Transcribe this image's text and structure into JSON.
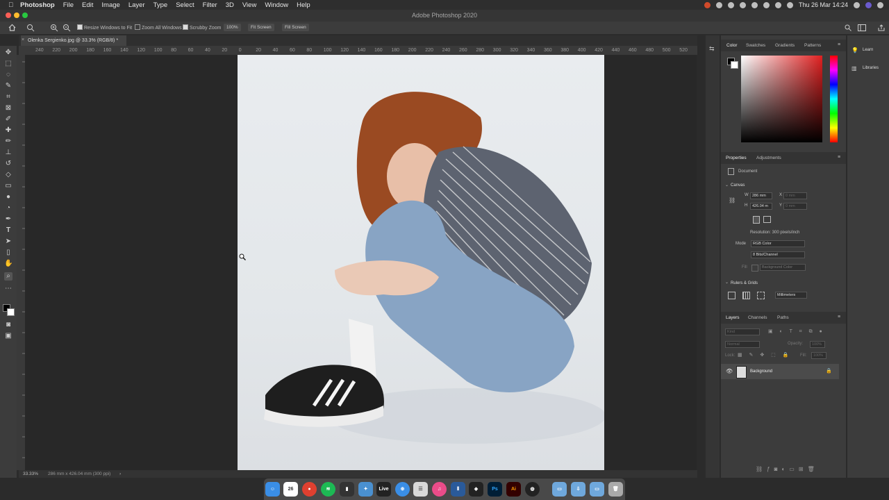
{
  "menubar": {
    "app": "Photoshop",
    "items": [
      "File",
      "Edit",
      "Image",
      "Layer",
      "Type",
      "Select",
      "Filter",
      "3D",
      "View",
      "Window",
      "Help"
    ],
    "clock": "Thu 26 Mar  14:24"
  },
  "window": {
    "title": "Adobe Photoshop 2020"
  },
  "options": {
    "resize_windows": "Resize Windows to Fit",
    "zoom_all": "Zoom All Windows",
    "scrubby_zoom": "Scrubby Zoom",
    "zoom_pct": "100%",
    "fit_screen": "Fit Screen",
    "fill_screen": "Fill Screen"
  },
  "document": {
    "tab_title": "Olenka Sergienko.jpg @ 33.3% (RGB/8) *"
  },
  "ruler": {
    "h_ticks": [
      "240",
      "220",
      "200",
      "180",
      "160",
      "140",
      "120",
      "100",
      "80",
      "60",
      "40",
      "20",
      "0",
      "20",
      "40",
      "60",
      "80",
      "100",
      "120",
      "140",
      "160",
      "180",
      "200",
      "220",
      "240",
      "260",
      "280",
      "300",
      "320",
      "340",
      "360",
      "380",
      "400",
      "420",
      "440",
      "460",
      "480",
      "500",
      "520"
    ]
  },
  "status": {
    "zoom": "33.33%",
    "size": "286 mm x 426.04 mm (300 ppi)"
  },
  "color_panel": {
    "tabs": [
      "Color",
      "Swatches",
      "Gradients",
      "Patterns"
    ]
  },
  "properties_panel": {
    "tabs": [
      "Properties",
      "Adjustments"
    ],
    "doc_label": "Document",
    "canvas_label": "Canvas",
    "w_label": "W",
    "w_value": "286 mm",
    "h_label": "H",
    "h_value": "426.04 m",
    "x_label": "X",
    "x_placeholder": "0 mm",
    "y_label": "Y",
    "y_placeholder": "0 mm",
    "resolution": "Resolution: 300 pixels/inch",
    "mode_label": "Mode",
    "mode_value": "RGB Color",
    "bits_value": "8 Bits/Channel",
    "fill_label": "Fill",
    "fill_value": "Background Color",
    "rulers_label": "Rulers & Grids",
    "units_value": "Millimeters"
  },
  "layers_panel": {
    "tabs": [
      "Layers",
      "Channels",
      "Paths"
    ],
    "kind_placeholder": "Kind",
    "blend_mode": "Normal",
    "opacity_label": "Opacity:",
    "opacity_value": "100%",
    "lock_label": "Lock:",
    "fill_label": "Fill:",
    "fill_value": "100%",
    "layer_name": "Background"
  },
  "learn_panel": {
    "learn": "Learn",
    "libraries": "Libraries"
  },
  "dock": {
    "live_label": "Live",
    "ps_label": "Ps",
    "ai_label": "Ai"
  },
  "colors": {
    "accent": "#1473e6",
    "canvas_bg": "#282828",
    "panel_bg": "#3c3c3c"
  }
}
